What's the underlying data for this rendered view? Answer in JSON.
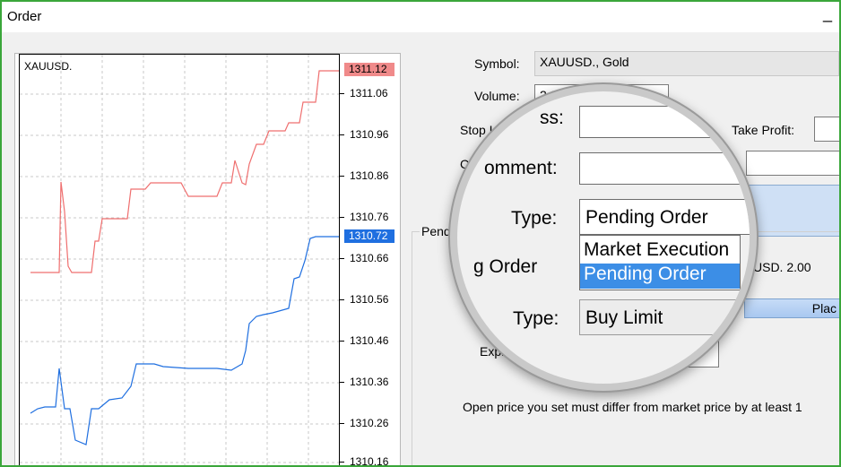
{
  "window": {
    "title": "Order",
    "minimize_glyph": "_"
  },
  "chart": {
    "symbol": "XAUUSD.",
    "y_ticks": [
      "1311.06",
      "1310.96",
      "1310.86",
      "1310.76",
      "1310.66",
      "1310.56",
      "1310.46",
      "1310.36",
      "1310.26",
      "1310.16"
    ],
    "ask_tag": "1311.12",
    "bid_tag": "1310.72",
    "colors": {
      "ask": "#ef6f6f",
      "bid": "#1f6fe0",
      "ask_tag_bg": "#f08a8a",
      "bid_tag_bg": "#1f6fe0"
    }
  },
  "form": {
    "symbol_label": "Symbol:",
    "symbol_value": "XAUUSD., Gold",
    "volume_label": "Volume:",
    "volume_value": "2.0",
    "stoploss_label": "Stop Lo",
    "takeprofit_label": "Take Profit:",
    "comment_label": "Co",
    "pending_group_label": "Pendi",
    "expiry_label": "Expi",
    "partial_usd": "USD. 2.00",
    "place_button": "Plac",
    "note": "Open price you set must differ from market price by at least  1"
  },
  "magnifier": {
    "stoploss_label_part": "ss:",
    "comment_label_part": "omment:",
    "type_label": "Type:",
    "type_value": "Pending Order",
    "options": [
      "Market Execution",
      "Pending Order"
    ],
    "selected_option": "Pending Order",
    "pending_heading": "g Order",
    "order_type_label": "Type:",
    "order_type_value": "Buy Limit"
  }
}
